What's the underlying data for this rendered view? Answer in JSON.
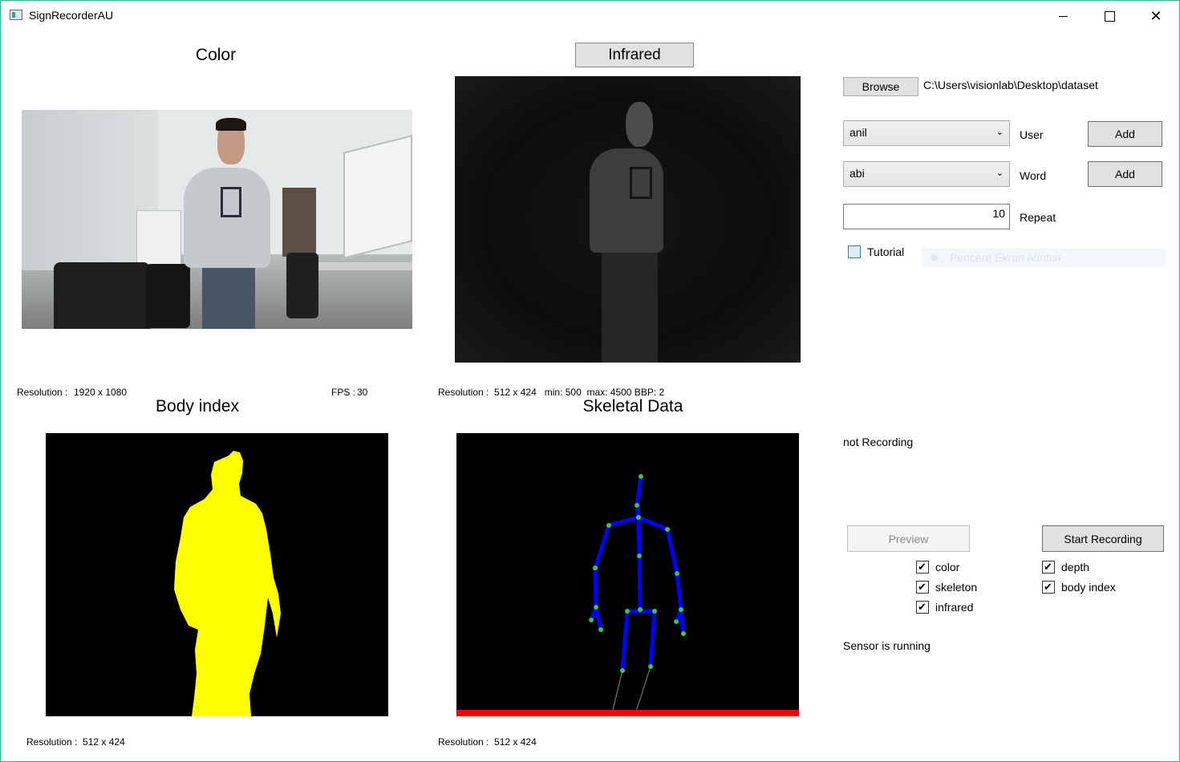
{
  "window": {
    "title": "SignRecorderAU",
    "minimize_glyph": "",
    "close_glyph": "✕"
  },
  "panels": {
    "color": {
      "title": "Color",
      "resolution_label": "Resolution :",
      "resolution_value": "1920 x 1080",
      "fps_label": "FPS :",
      "fps_value": "30"
    },
    "infrared": {
      "title": "Infrared",
      "info": "Resolution :  512 x 424   min: 500  max: 4500 BBP: 2"
    },
    "body_index": {
      "title": "Body index",
      "info": "Resolution :  512 x 424"
    },
    "skeletal": {
      "title": "Skeletal Data",
      "info": "Resolution :  512 x 424"
    }
  },
  "controls": {
    "browse_label": "Browse",
    "path": "C:\\Users\\visionlab\\Desktop\\dataset",
    "user_value": "anil",
    "user_label": "User",
    "user_add": "Add",
    "word_value": "abi",
    "word_label": "Word",
    "word_add": "Add",
    "repeat_value": "10",
    "repeat_label": "Repeat",
    "tutorial_label": "Tutorial",
    "ghost_item": "Pencere Ekran Alıntısı",
    "status": "not Recording",
    "preview_label": "Preview",
    "start_label": "Start Recording",
    "sensor_status": "Sensor is running",
    "checks": {
      "color": "color",
      "skeleton": "skeleton",
      "infrared": "infrared",
      "depth": "depth",
      "body_index": "body index"
    }
  },
  "colors": {
    "accent_border": "#2fb58a",
    "body_index_fill": "#ffff00",
    "skeleton_bones": "#0000ff",
    "skeleton_joints": "#3cc83c",
    "floor": "#ff0000"
  }
}
